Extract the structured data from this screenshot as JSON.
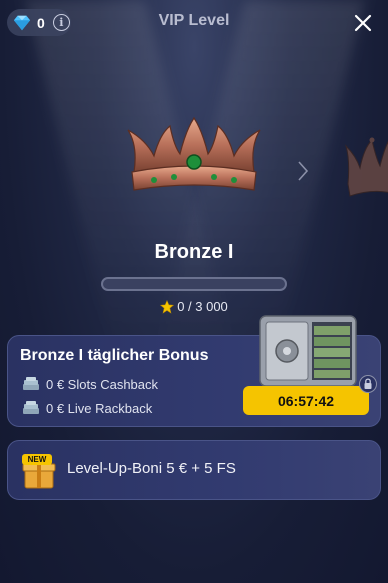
{
  "header": {
    "title": "VIP Level",
    "gem_count": "0",
    "info_label": "i",
    "close_icon": "close-icon"
  },
  "crowns": {
    "current_icon": "crown-bronze-icon",
    "next_icon": "crown-next-icon",
    "nav_icon": "chevron-right-icon"
  },
  "level": {
    "name": "Bronze I",
    "points_text": "0 / 3 000",
    "progress_fraction": 0
  },
  "bonus_card": {
    "title": "Bronze I täglicher Bonus",
    "rows": [
      {
        "icon": "money-stack-icon",
        "text": "0 € Slots Cashback"
      },
      {
        "icon": "money-stack-icon",
        "text": "0 € Live Rackback"
      }
    ],
    "timer": "06:57:42",
    "safe_icon": "safe-icon",
    "lock_icon": "lock-icon"
  },
  "levelup_card": {
    "badge": "NEW",
    "text": "Level-Up-Boni 5 € + 5 FS",
    "gift_icon": "gift-icon"
  },
  "colors": {
    "accent": "#f5c400",
    "background": "#1b2140",
    "card": "#2f3768"
  }
}
